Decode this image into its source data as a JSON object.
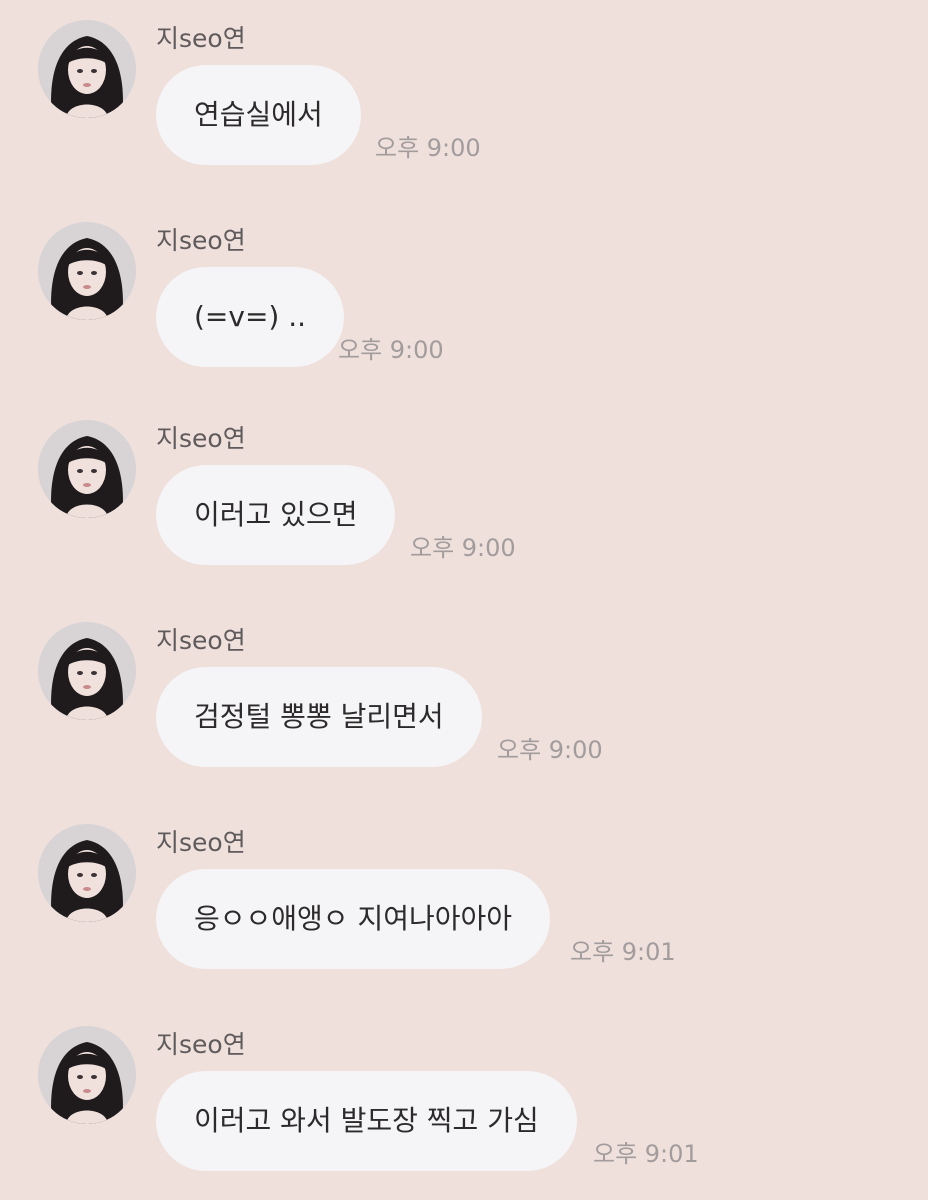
{
  "chat": {
    "messages": [
      {
        "sender": "지seo연",
        "text": "연습실에서",
        "time": "오후 9:00"
      },
      {
        "sender": "지seo연",
        "text": "(=v=) ..",
        "time": "오후 9:00"
      },
      {
        "sender": "지seo연",
        "text": "이러고 있으면",
        "time": "오후 9:00"
      },
      {
        "sender": "지seo연",
        "text": "검정털 뽕뽕 날리면서",
        "time": "오후 9:00"
      },
      {
        "sender": "지seo연",
        "text": "응ㅇㅇ애앵ㅇ 지여나아아아",
        "time": "오후 9:01"
      },
      {
        "sender": "지seo연",
        "text": "이러고 와서 발도장 찍고 가심",
        "time": "오후 9:01"
      }
    ]
  },
  "colors": {
    "background": "#efe0dc",
    "bubble": "#f5f4f6",
    "sender_text": "#5f5a5b",
    "message_text": "#2c2a2b",
    "time_text": "#a29c9d"
  },
  "icons": {
    "avatar": "profile-photo-icon"
  }
}
